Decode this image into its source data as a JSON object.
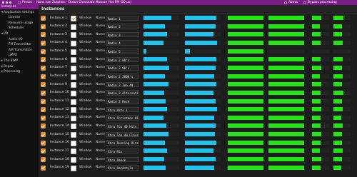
{
  "window": {
    "menu_label": "Preset",
    "title": "Hans van Zutphen - Dutch Chocolate Mousse Hot FM (50 µs)",
    "about_label": "About",
    "bypass_label": "Bypass processing"
  },
  "sidebar": {
    "items": [
      {
        "label": "Instances",
        "indent": 0,
        "arrow": "",
        "selected": true
      },
      {
        "label": "Application settings",
        "indent": 0,
        "arrow": "▾",
        "selected": false
      },
      {
        "label": "License",
        "indent": 2,
        "arrow": "",
        "selected": false
      },
      {
        "label": "Resource usage",
        "indent": 2,
        "arrow": "",
        "selected": false
      },
      {
        "label": "Scheduler",
        "indent": 2,
        "arrow": "",
        "selected": false
      },
      {
        "label": "I/O",
        "indent": 0,
        "arrow": "▾",
        "selected": false
      },
      {
        "label": "Audio I/O",
        "indent": 2,
        "arrow": "",
        "selected": false
      },
      {
        "label": "FM Transmitter",
        "indent": 2,
        "arrow": "",
        "selected": false
      },
      {
        "label": "AM Transmitter",
        "indent": 2,
        "arrow": "",
        "selected": false
      },
      {
        "label": "µMPX",
        "indent": 2,
        "arrow": "",
        "selected": false
      },
      {
        "label": "The BIMP",
        "indent": 0,
        "arrow": "▸",
        "selected": false
      },
      {
        "label": "Repair",
        "indent": 0,
        "arrow": "▸",
        "selected": false
      },
      {
        "label": "Processing",
        "indent": 0,
        "arrow": "▸",
        "selected": false
      }
    ]
  },
  "main": {
    "title": "Instances",
    "window_label": "Window",
    "name_label": "Name",
    "instances": [
      {
        "label": "Instance 1",
        "selected": true,
        "name": "Radio 1",
        "meters": [
          0.78,
          0.88,
          1.0,
          1.0,
          0.55,
          0.6
        ]
      },
      {
        "label": "Instance 2",
        "selected": false,
        "name": "Radio 2",
        "meters": [
          0.6,
          0.85,
          1.0,
          1.0,
          0.45,
          0.5
        ]
      },
      {
        "label": "Instance 3",
        "selected": false,
        "name": "Radio 3",
        "meters": [
          0.65,
          0.8,
          1.0,
          1.0,
          0.5,
          0.5
        ]
      },
      {
        "label": "Instance 4",
        "selected": false,
        "name": "Radio 4",
        "meters": [
          0.55,
          0.9,
          1.0,
          1.0,
          0.5,
          0.55
        ]
      },
      {
        "label": "Instance 5",
        "selected": false,
        "name": "Radio 5",
        "meters": [
          0.08,
          0.14,
          1.0,
          0.0,
          0.0,
          0.0
        ]
      },
      {
        "label": "Instance 6",
        "selected": false,
        "name": "Radio 2 80's",
        "meters": [
          0.65,
          0.88,
          1.0,
          1.0,
          0.5,
          0.55
        ]
      },
      {
        "label": "Instance 7",
        "selected": false,
        "name": "Radio 2 90's",
        "meters": [
          0.72,
          0.85,
          1.0,
          1.0,
          0.55,
          0.5
        ]
      },
      {
        "label": "Instance 8",
        "selected": false,
        "name": "Radio 2 2000's",
        "meters": [
          0.6,
          0.82,
          1.0,
          1.0,
          0.45,
          0.55
        ]
      },
      {
        "label": "Instance 9",
        "selected": false,
        "name": "Radio 2 Top 40",
        "meters": [
          0.7,
          0.88,
          1.0,
          1.0,
          0.55,
          0.5
        ]
      },
      {
        "label": "Instance 10",
        "selected": false,
        "name": "Radio 2 Alternative",
        "meters": [
          0.58,
          0.8,
          1.0,
          1.0,
          0.5,
          0.6
        ]
      },
      {
        "label": "Instance 11",
        "selected": false,
        "name": "Radio 2 Rock",
        "meters": [
          0.62,
          0.85,
          1.0,
          1.0,
          0.5,
          0.5
        ]
      },
      {
        "label": "Instance 12",
        "selected": false,
        "name": "Xtra Hits 1",
        "meters": [
          0.66,
          0.9,
          1.0,
          1.0,
          0.55,
          0.55
        ]
      },
      {
        "label": "Instance 13",
        "selected": false,
        "name": "Xtra Christmas Hits",
        "meters": [
          0.55,
          0.82,
          1.0,
          1.0,
          0.5,
          0.45
        ]
      },
      {
        "label": "Instance 14",
        "selected": false,
        "name": "Xtra Top 40 Hits",
        "meters": [
          0.64,
          0.86,
          1.0,
          1.0,
          0.5,
          0.55
        ]
      },
      {
        "label": "Instance 15",
        "selected": false,
        "name": "Xtra Top 40 Classic",
        "meters": [
          0.7,
          0.84,
          1.0,
          1.0,
          0.55,
          0.5
        ]
      },
      {
        "label": "Instance 16",
        "selected": false,
        "name": "Xtra Running Hits",
        "meters": [
          0.6,
          0.88,
          1.0,
          1.0,
          0.5,
          0.5
        ]
      },
      {
        "label": "Instance 17",
        "selected": false,
        "name": "Xtra Mix",
        "meters": [
          0.66,
          0.8,
          1.0,
          1.0,
          0.45,
          0.55
        ]
      },
      {
        "label": "Instance 18",
        "selected": false,
        "name": "Xtra Dance",
        "meters": [
          0.58,
          0.86,
          1.0,
          1.0,
          0.55,
          0.5
        ]
      },
      {
        "label": "Instance 19",
        "selected": false,
        "name": "Xtra Hardstyle",
        "meters": [
          0.62,
          0.82,
          1.0,
          1.0,
          0.5,
          0.45
        ]
      }
    ]
  },
  "colors": {
    "accent": "#7a1d86",
    "checkbox": "#e08a2e",
    "meter_cyan": "#1ec4ef",
    "meter_green": "#25e615",
    "meter_dark": "#0b0b0b"
  }
}
